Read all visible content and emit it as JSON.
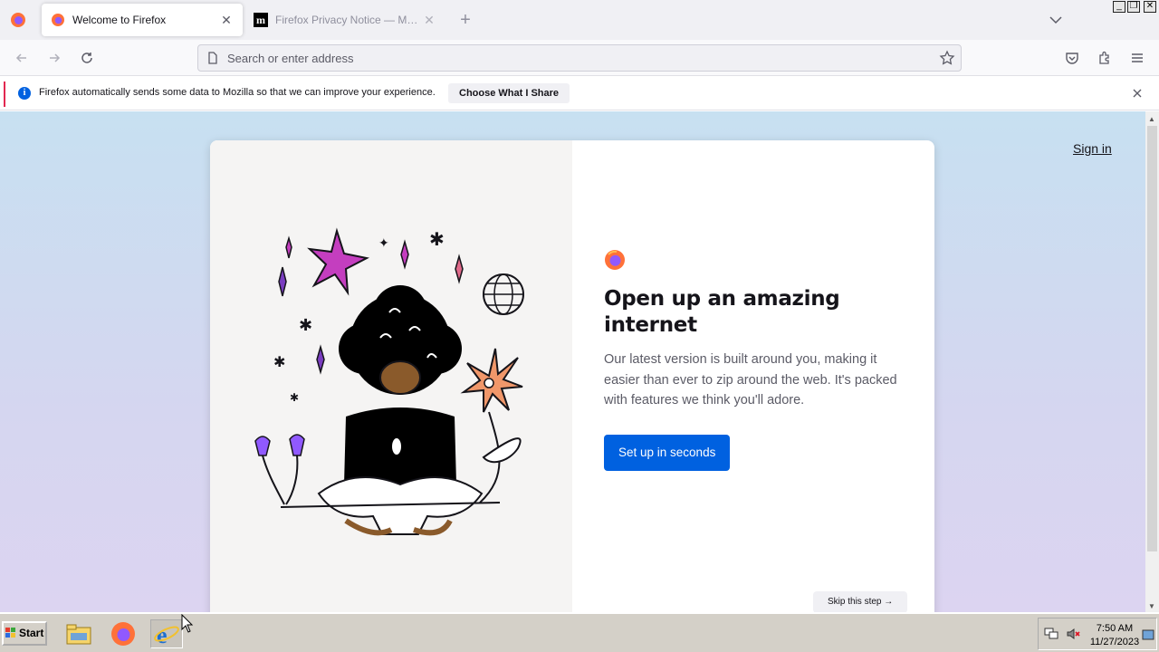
{
  "tabs": [
    {
      "title": "Welcome to Firefox",
      "active": true
    },
    {
      "title": "Firefox Privacy Notice — Mozilla",
      "active": false
    }
  ],
  "urlbar": {
    "placeholder": "Search or enter address"
  },
  "notification": {
    "message": "Firefox automatically sends some data to Mozilla so that we can improve your experience.",
    "button_label": "Choose What I Share"
  },
  "page": {
    "sign_in": "Sign in",
    "heading": "Open up an amazing internet",
    "body": "Our latest version is built around you, making it easier than ever to zip around the web. It's packed with features we think you'll adore.",
    "cta": "Set up in seconds",
    "skip": "Skip this step"
  },
  "taskbar": {
    "start_label": "Start",
    "time": "7:50 AM",
    "date": "11/27/2023"
  },
  "colors": {
    "accent_blue": "#0061e0",
    "firefox_orange": "#ff7139",
    "firefox_purple": "#9059ff"
  }
}
